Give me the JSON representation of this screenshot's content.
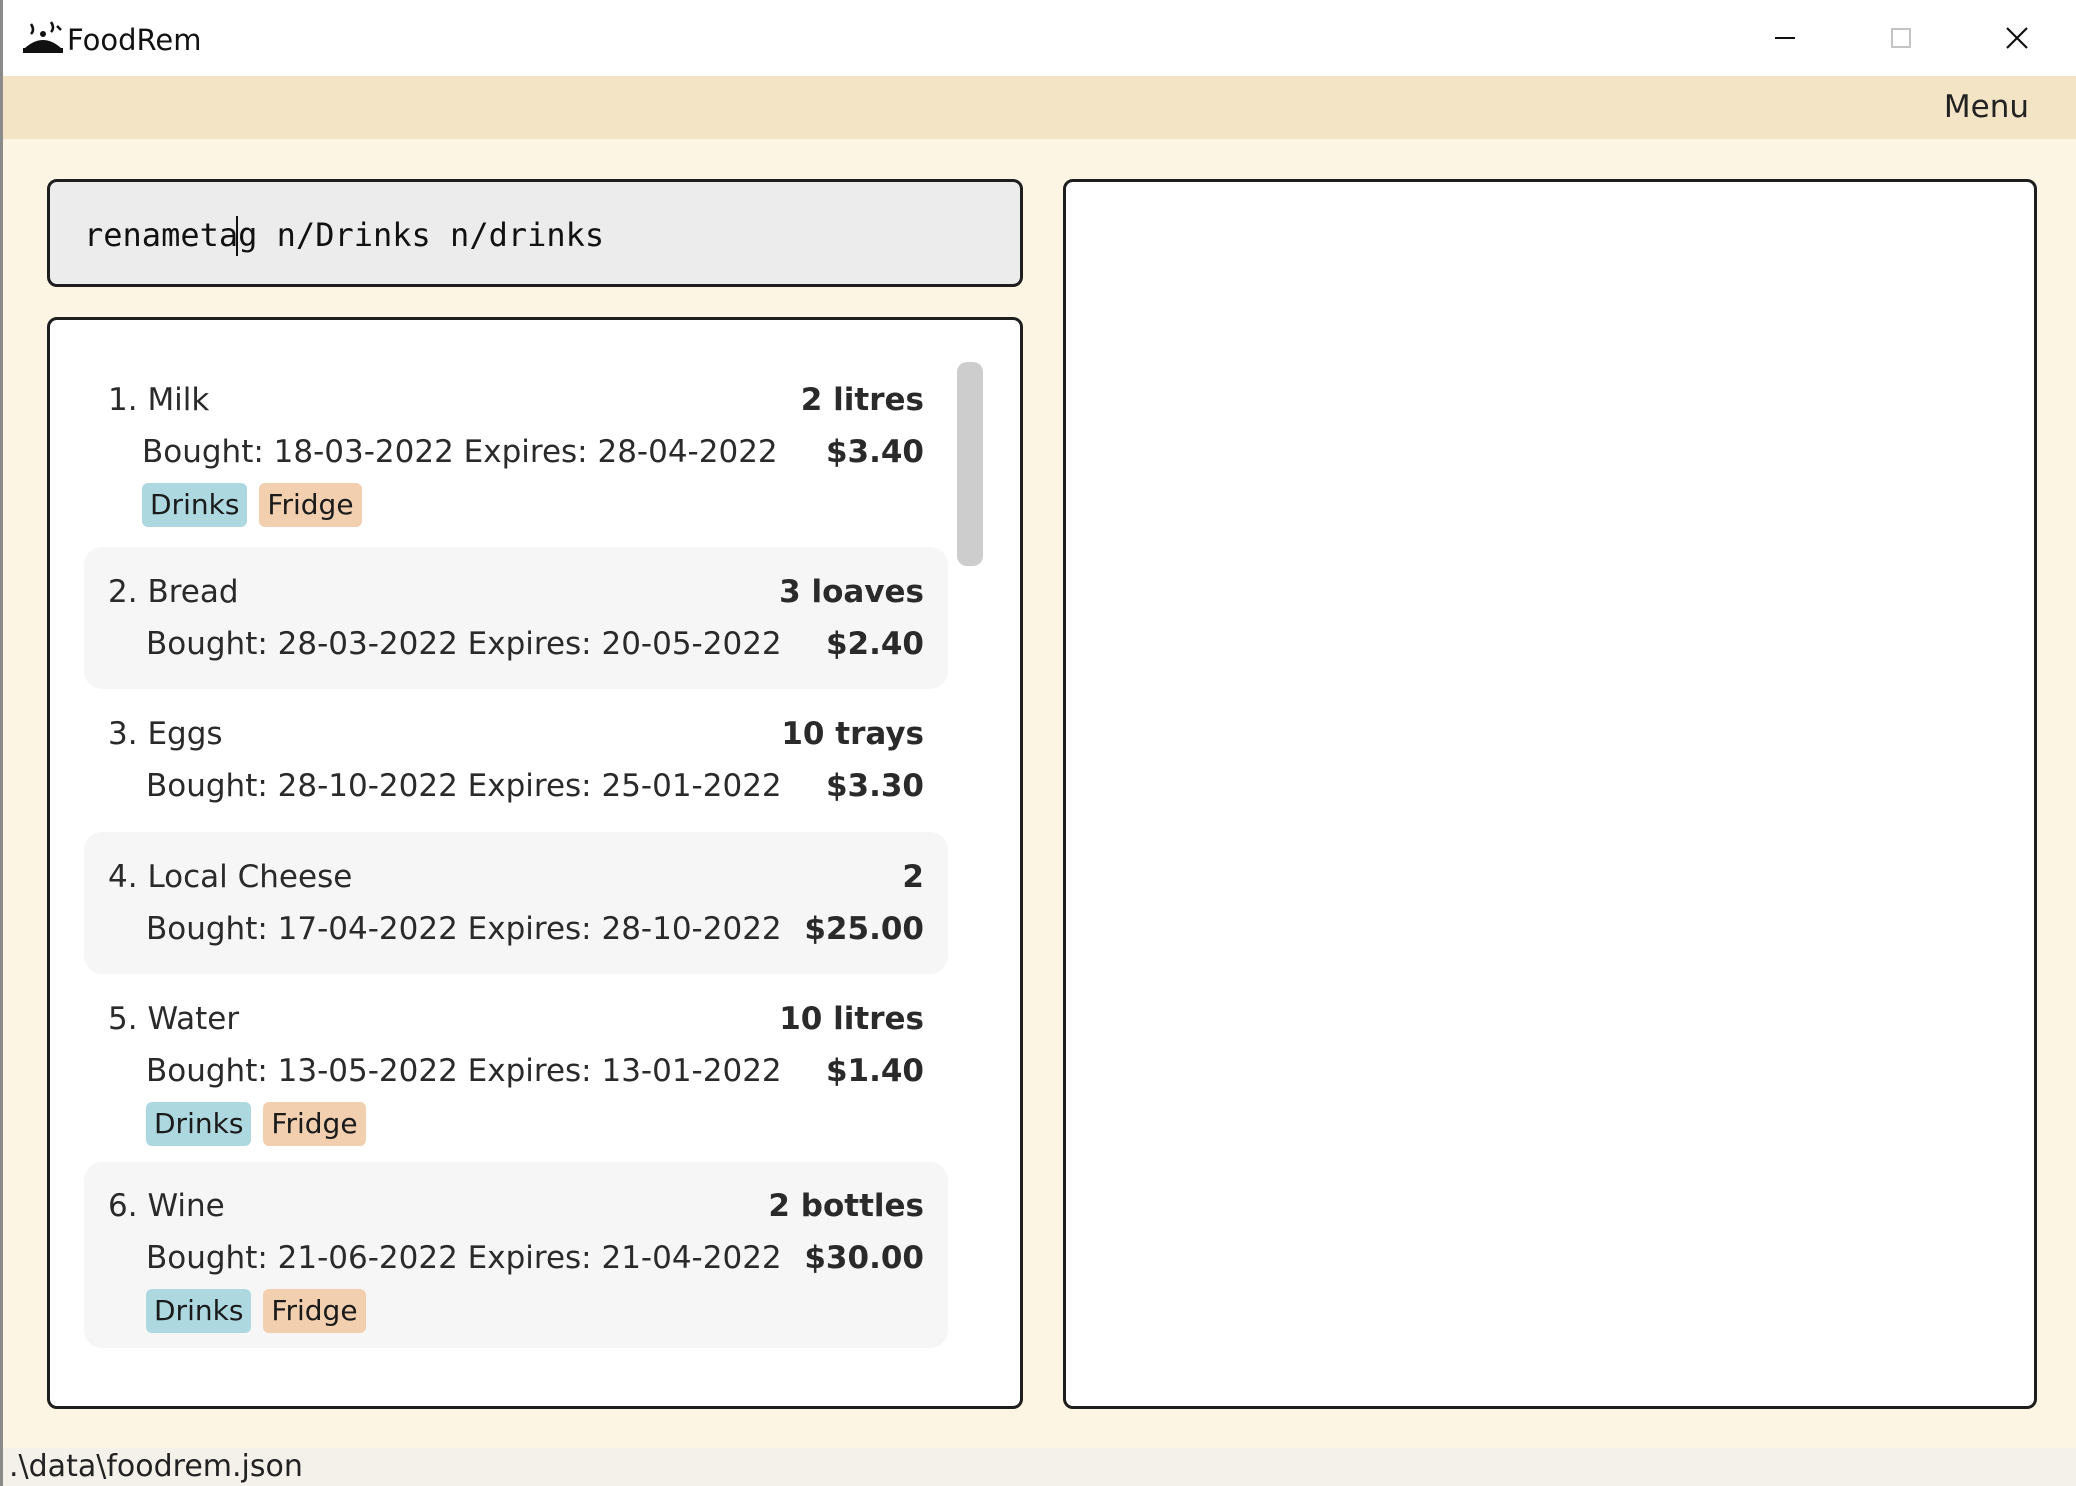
{
  "window": {
    "title": "FoodRem",
    "icon": "foodrem-logo-icon",
    "controls": [
      "minimize-icon",
      "maximize-icon",
      "close-icon"
    ]
  },
  "menubar": {
    "menu_label": "Menu"
  },
  "command_box": {
    "value": "renametag n/Drinks n/drinks"
  },
  "result_display": {
    "text": ""
  },
  "items": [
    {
      "index": "1.",
      "name": "Milk",
      "quantity": "2 litres",
      "dates": "Bought: 18-03-2022  Expires: 28-04-2022",
      "price": "$3.40",
      "tags": [
        "Drinks",
        "Fridge"
      ]
    },
    {
      "index": "2.",
      "name": "Bread",
      "quantity": "3 loaves",
      "dates": "Bought: 28-03-2022  Expires: 20-05-2022",
      "price": "$2.40",
      "tags": []
    },
    {
      "index": "3.",
      "name": "Eggs",
      "quantity": "10 trays",
      "dates": "Bought: 28-10-2022  Expires: 25-01-2022",
      "price": "$3.30",
      "tags": []
    },
    {
      "index": "4.",
      "name": "Local Cheese",
      "quantity": "2",
      "dates": "Bought: 17-04-2022  Expires: 28-10-2022",
      "price": "$25.00",
      "tags": []
    },
    {
      "index": "5.",
      "name": "Water",
      "quantity": "10 litres",
      "dates": "Bought: 13-05-2022  Expires: 13-01-2022",
      "price": "$1.40",
      "tags": [
        "Drinks",
        "Fridge"
      ]
    },
    {
      "index": "6.",
      "name": "Wine",
      "quantity": "2 bottles",
      "dates": "Bought: 21-06-2022  Expires: 21-04-2022",
      "price": "$30.00",
      "tags": [
        "Drinks",
        "Fridge"
      ]
    }
  ],
  "statusbar": {
    "path": ".\\data\\foodrem.json"
  },
  "colors": {
    "background": "#fdf5e3",
    "menubar": "#f2e4c4",
    "tag_drinks": "#add8e0",
    "tag_fridge": "#f2cfae"
  }
}
